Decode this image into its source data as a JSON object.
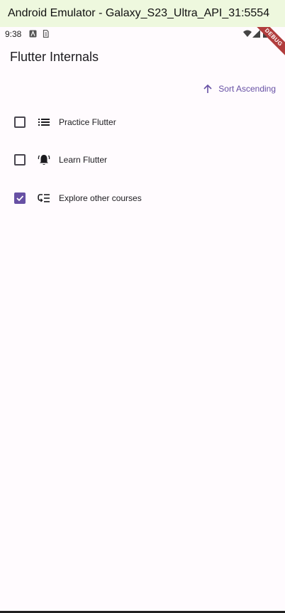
{
  "window": {
    "title": "Android Emulator - Galaxy_S23_Ultra_API_31:5554"
  },
  "statusbar": {
    "time": "9:38",
    "left_icons": [
      "a-icon",
      "sim-icon"
    ],
    "right_icons": [
      "wifi-icon",
      "signal-icon",
      "battery-icon"
    ]
  },
  "debug_banner": {
    "label": "DEBUG",
    "color": "#b13d3d"
  },
  "appbar": {
    "title": "Flutter Internals"
  },
  "sort": {
    "label": "Sort Ascending",
    "icon": "arrow-up-icon",
    "color": "#6750a4"
  },
  "items": [
    {
      "label": "Practice Flutter",
      "checked": false,
      "icon": "list-icon"
    },
    {
      "label": "Learn Flutter",
      "checked": false,
      "icon": "notification-bell-icon"
    },
    {
      "label": "Explore other courses",
      "checked": true,
      "icon": "playlist-icon"
    }
  ],
  "colors": {
    "accent": "#6750a4",
    "background": "#fffbfe",
    "titlebar": "#eef8de"
  }
}
